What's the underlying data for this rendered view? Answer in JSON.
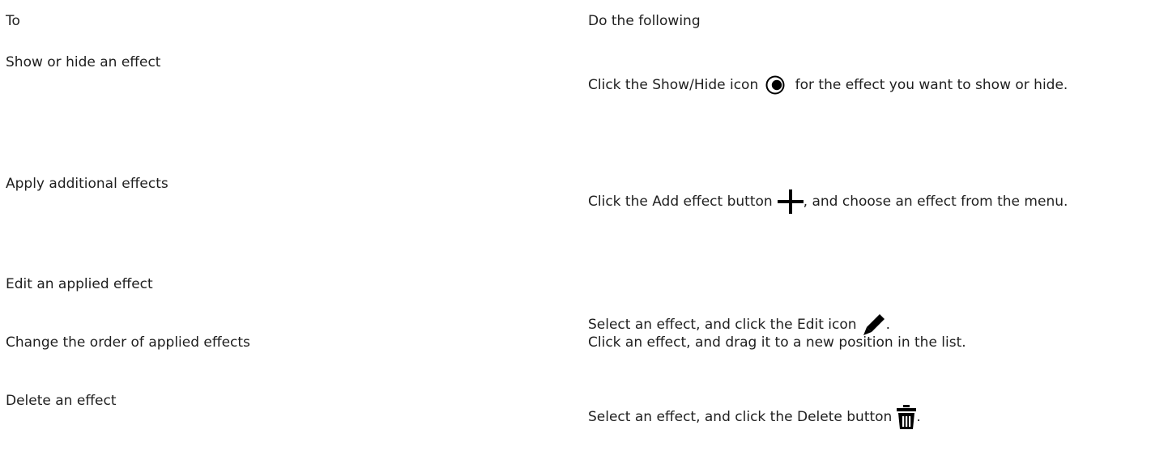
{
  "table": {
    "headers": {
      "col1": "To",
      "col2": "Do the following"
    },
    "rows": [
      {
        "task": "Show or hide an effect",
        "pre": "Click the ",
        "ui": "Show/Hide",
        "mid": " icon",
        "icon": "eye-icon",
        "post": " for the effect you want to show or hide."
      },
      {
        "task": "Apply additional effects",
        "pre": "Click the ",
        "ui": "Add effect",
        "mid": " button",
        "icon": "plus-icon",
        "post": ", and choose an effect from the menu."
      },
      {
        "task": "Edit an applied effect",
        "pre": "Select an effect, and click the ",
        "ui": "Edit",
        "mid": " icon",
        "icon": "pencil-icon",
        "post": "."
      },
      {
        "task": "Change the order of applied effects",
        "pre": "Click an effect, and drag it to a new position in the list."
      },
      {
        "task": "Delete an effect",
        "pre": "Select an effect, and click the ",
        "ui": "Delete",
        "mid": " button",
        "icon": "trash-icon",
        "post": "."
      }
    ]
  }
}
